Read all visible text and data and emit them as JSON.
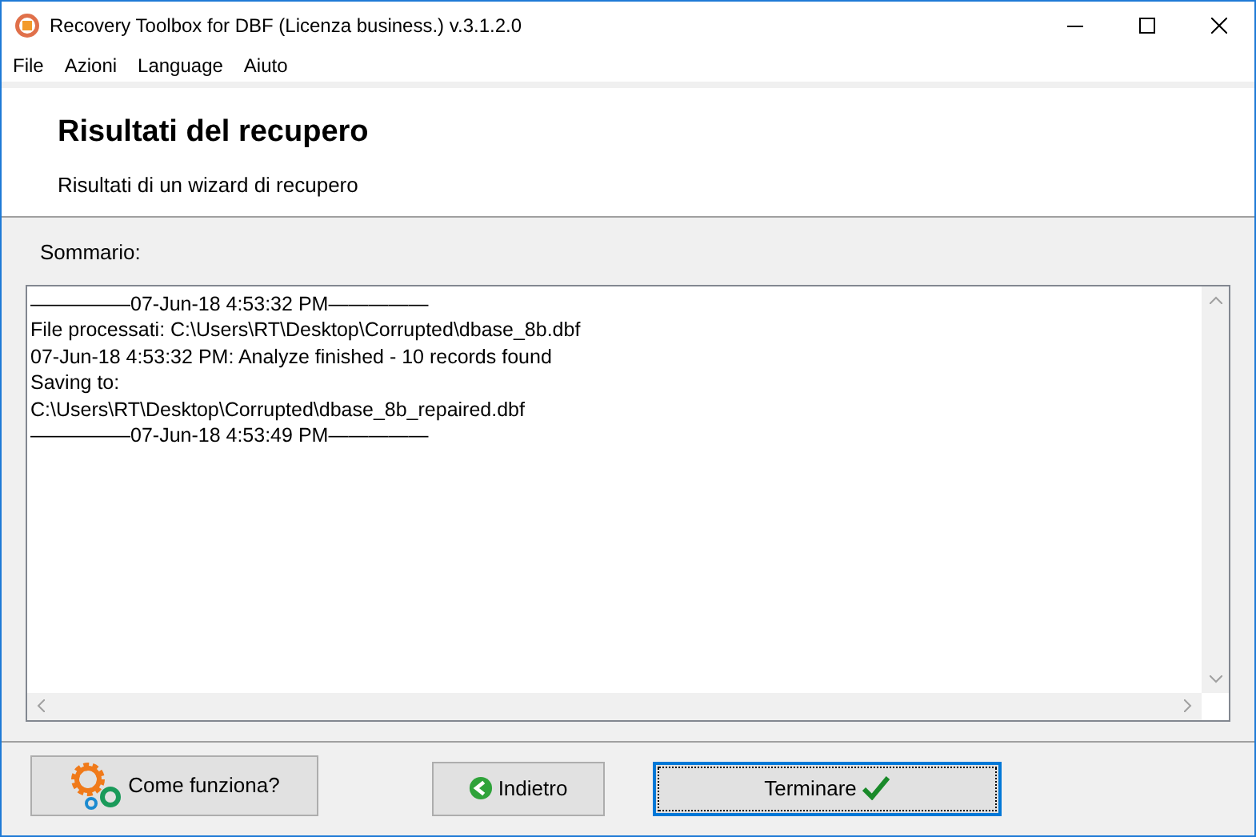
{
  "window": {
    "title": "Recovery Toolbox for DBF (Licenza business.) v.3.1.2.0"
  },
  "menu": [
    "File",
    "Azioni",
    "Language",
    "Aiuto"
  ],
  "header": {
    "title": "Risultati del recupero",
    "subtitle": "Risultati di un wizard di recupero"
  },
  "summary": {
    "label": "Sommario:",
    "lines": [
      "—————07-Jun-18 4:53:32 PM—————",
      "File processati: C:\\Users\\RT\\Desktop\\Corrupted\\dbase_8b.dbf",
      "07-Jun-18 4:53:32 PM: Analyze finished - 10 records found",
      "Saving to:",
      "C:\\Users\\RT\\Desktop\\Corrupted\\dbase_8b_repaired.dbf",
      "—————07-Jun-18 4:53:49 PM—————"
    ]
  },
  "buttons": [
    {
      "kind": "help",
      "label": "Come funziona?",
      "focused": false
    },
    {
      "kind": "back",
      "label": "Indietro",
      "focused": false
    },
    {
      "kind": "finish",
      "label": "Terminare",
      "focused": true
    }
  ]
}
